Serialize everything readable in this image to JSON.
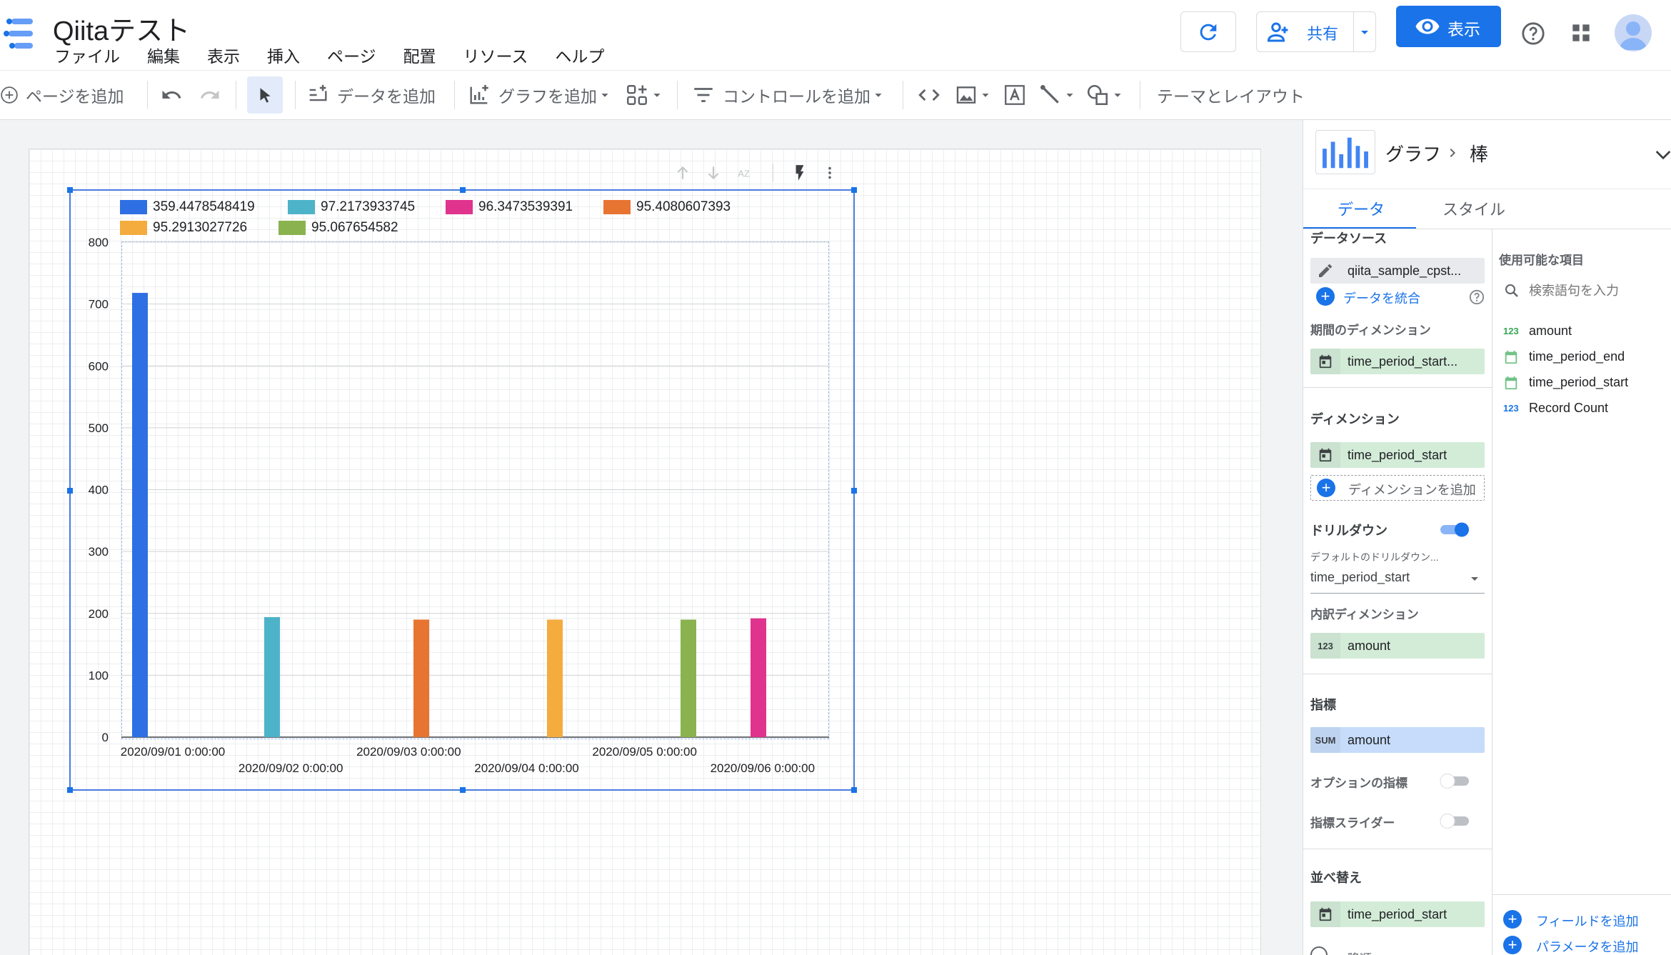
{
  "app": {
    "title": "Qiitaテスト",
    "menu": [
      "ファイル",
      "編集",
      "表示",
      "挿入",
      "ページ",
      "配置",
      "リソース",
      "ヘルプ"
    ]
  },
  "header": {
    "share_label": "共有",
    "view_label": "表示"
  },
  "toolbar": {
    "add_page": "ページを追加",
    "add_data": "データを追加",
    "add_chart": "グラフを追加",
    "add_control": "コントロールを追加",
    "theme_layout": "テーマとレイアウト"
  },
  "chart_data": {
    "type": "bar",
    "legend": [
      "359.4478548419",
      "97.2173933745",
      "96.3473539391",
      "95.4080607393",
      "95.2913027726",
      "95.067654582"
    ],
    "legend_colors": [
      "#2f6fe4",
      "#4db3c8",
      "#e0338d",
      "#e87432",
      "#f4ac3e",
      "#8ab24f"
    ],
    "legend_placement": "top-left",
    "yticks": [
      "800",
      "700",
      "600",
      "500",
      "400",
      "300",
      "200",
      "100",
      "0"
    ],
    "ylim": [
      0,
      800
    ],
    "categories": [
      "2020/09/01 0:00:00",
      "2020/09/02 0:00:00",
      "2020/09/03 0:00:00",
      "2020/09/04 0:00:00",
      "2020/09/05 0:00:00",
      "2020/09/06 0:00:00"
    ],
    "bars": [
      {
        "category": "2020/09/01 0:00:00",
        "series": "359.4478548419",
        "value": 718
      },
      {
        "category": "2020/09/02 0:00:00",
        "series": "97.2173933745",
        "value": 194
      },
      {
        "category": "2020/09/03 0:00:00",
        "series": "95.4080607393",
        "value": 190
      },
      {
        "category": "2020/09/04 0:00:00",
        "series": "95.2913027726",
        "value": 190
      },
      {
        "category": "2020/09/05 0:00:00",
        "series": "95.067654582",
        "value": 190
      },
      {
        "category": "2020/09/06 0:00:00",
        "series": "96.3473539391",
        "value": 192
      }
    ]
  },
  "panel": {
    "breadcrumb_root": "グラフ",
    "breadcrumb_leaf": "棒",
    "tab_data": "データ",
    "tab_style": "スタイル",
    "data_source_title": "データソース",
    "data_source_name": "qiita_sample_cpst...",
    "blend_label": "データを統合",
    "date_dim_title": "期間のディメンション",
    "date_dim_value": "time_period_start...",
    "dim_title": "ディメンション",
    "dim_value": "time_period_start",
    "add_dim": "ディメンションを追加",
    "drilldown_title": "ドリルダウン",
    "default_drill_label": "デフォルトのドリルダウン...",
    "default_drill_value": "time_period_start",
    "breakdown_title": "内訳ディメンション",
    "breakdown_value": "amount",
    "breakdown_icon": "123",
    "metric_title": "指標",
    "metric_value": "amount",
    "metric_icon": "SUM",
    "optional_metric": "オプションの指標",
    "metric_slider": "指標スライダー",
    "sort_title": "並べ替え",
    "sort_value": "time_period_start",
    "sort_more": "降順",
    "available_title": "使用可能な項目",
    "search_placeholder": "検索語句を入力",
    "fields": [
      {
        "icon": "123",
        "name": "amount",
        "color": "#34a853"
      },
      {
        "icon": "calendar",
        "name": "time_period_end",
        "color": "#34a853"
      },
      {
        "icon": "calendar",
        "name": "time_period_start",
        "color": "#34a853"
      },
      {
        "icon": "123",
        "name": "Record Count",
        "color": "#1a73e8"
      }
    ],
    "add_field": "フィールドを追加",
    "add_param": "パラメータを追加"
  }
}
